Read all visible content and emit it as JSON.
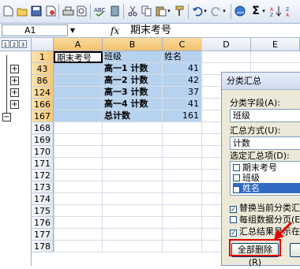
{
  "toolbar": {
    "icons": [
      "new-icon",
      "open-icon",
      "save-icon",
      "permission-icon",
      "print-icon",
      "print-preview-icon",
      "spelling-icon",
      "cut-icon",
      "copy-icon",
      "paste-icon",
      "format-painter-icon",
      "undo-icon",
      "redo-icon",
      "hyperlink-icon",
      "autosum-icon",
      "sort-icon"
    ]
  },
  "formula_bar": {
    "name_box": "A1",
    "fx": "fx",
    "content": "期末考号"
  },
  "outline_levels": [
    "1",
    "2",
    "3"
  ],
  "columns": [
    "A",
    "B",
    "C",
    "D",
    "E"
  ],
  "rows": [
    {
      "num": "1",
      "a": "期末考号",
      "b": "班级",
      "c": "姓名"
    },
    {
      "num": "43",
      "a": "",
      "b": "高一1 计数",
      "c": "41"
    },
    {
      "num": "86",
      "a": "",
      "b": "高一2 计数",
      "c": "42"
    },
    {
      "num": "124",
      "a": "",
      "b": "高一3 计数",
      "c": "37"
    },
    {
      "num": "166",
      "a": "",
      "b": "高一4 计数",
      "c": "41"
    },
    {
      "num": "167",
      "a": "",
      "b": "总计数",
      "c": "161"
    }
  ],
  "empty_rows": [
    "168",
    "169",
    "170",
    "171",
    "172",
    "173",
    "174",
    "175",
    "176",
    "177",
    "178"
  ],
  "dialog": {
    "title": "分类汇总",
    "group_by_label": "分类字段(A):",
    "group_by_value": "班级",
    "function_label": "汇总方式(U):",
    "function_value": "计数",
    "add_to_label": "选定汇总项(D):",
    "add_to_items": [
      {
        "label": "期末考号",
        "checked": false
      },
      {
        "label": "班级",
        "checked": false
      },
      {
        "label": "姓名",
        "checked": true
      }
    ],
    "options": [
      {
        "label": "替换当前分类汇",
        "checked": true
      },
      {
        "label": "每组数据分页(E)",
        "checked": false
      },
      {
        "label": "汇总结果显示在",
        "checked": true
      }
    ],
    "remove_all_button": "全部删除(R)"
  },
  "colors": {
    "highlight": "#e00000",
    "selection": "#b7d2ee"
  }
}
